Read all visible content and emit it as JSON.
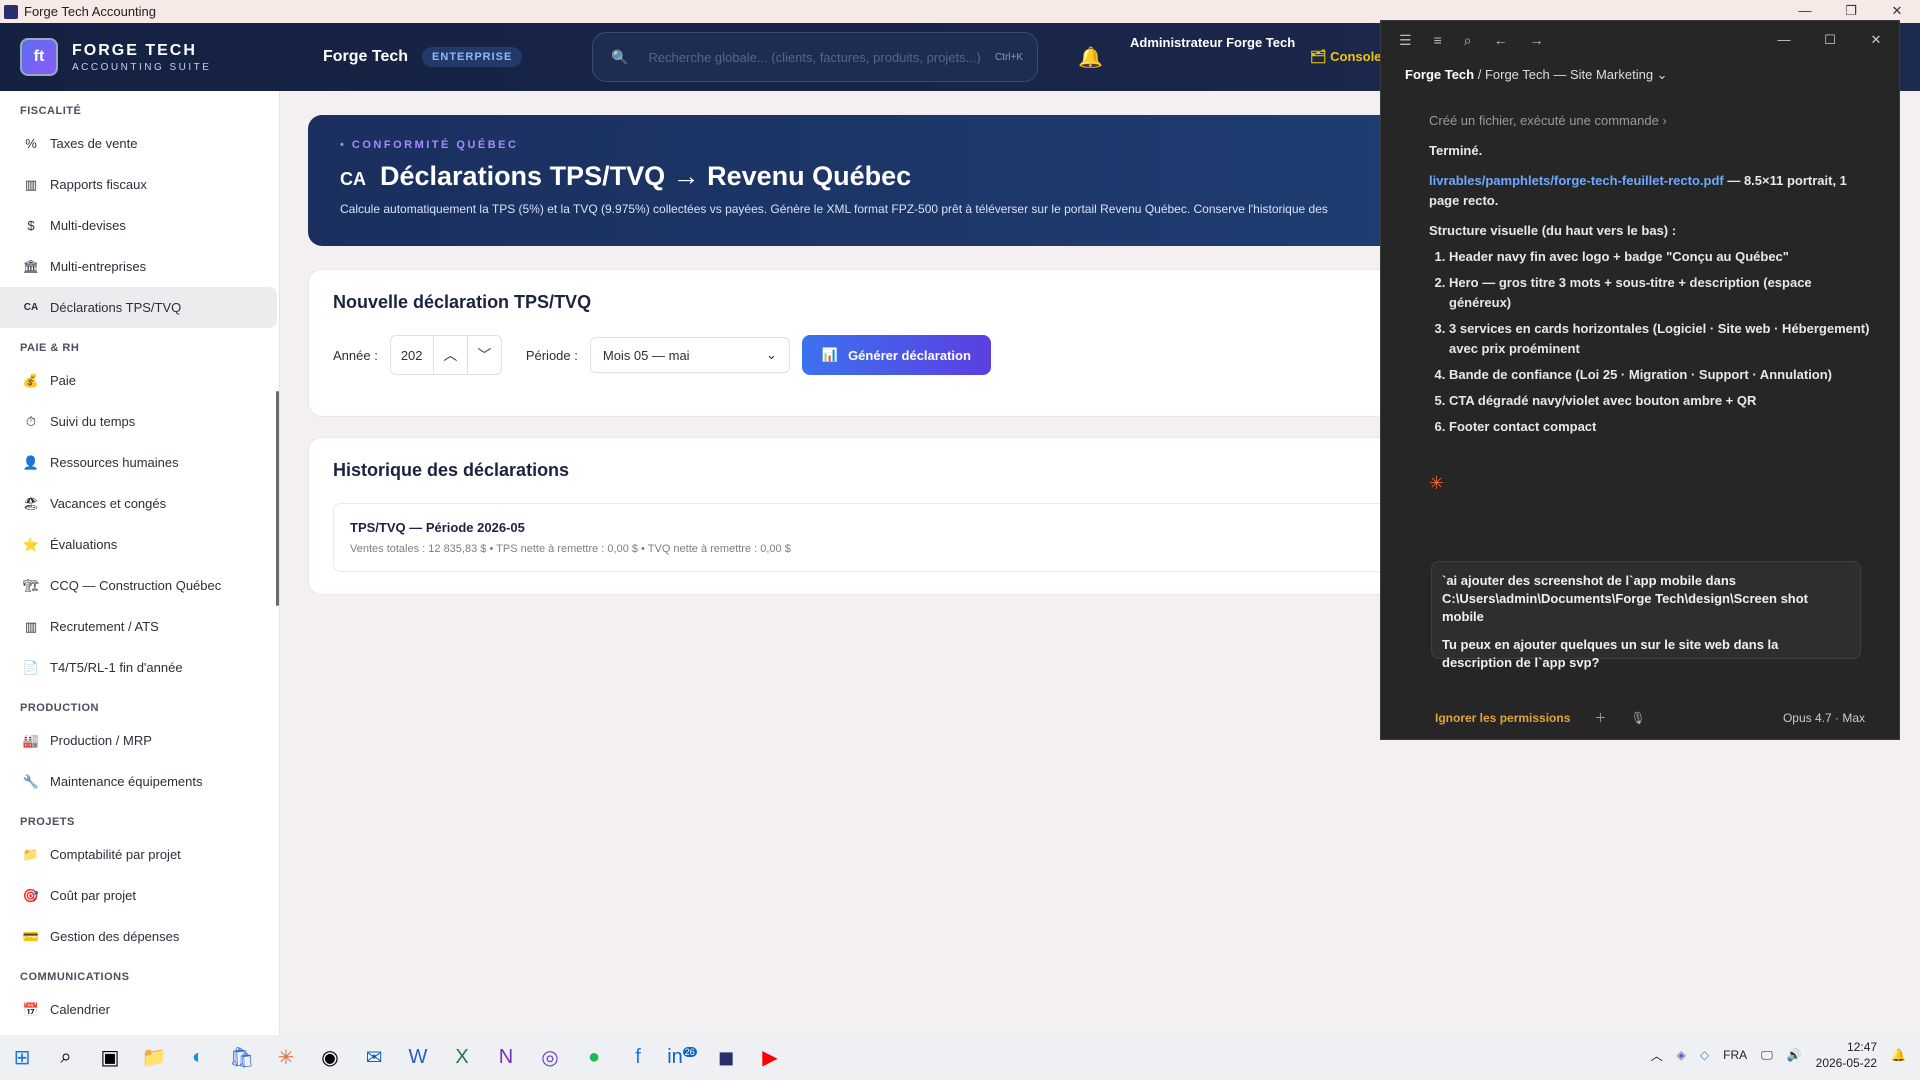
{
  "window": {
    "title": "Forge Tech Accounting"
  },
  "header": {
    "logo_main": "FORGE TECH",
    "logo_sub": "ACCOUNTING SUITE",
    "brand": "Forge Tech",
    "badge": "ENTERPRISE",
    "search_placeholder": "Recherche globale... (clients, factures, produits, projets...)",
    "search_shortcut": "Ctrl+K",
    "admin": "Administrateur Forge Tech",
    "console": "Console"
  },
  "sidebar": {
    "sections": [
      {
        "title": "FISCALITÉ",
        "items": [
          {
            "icon": "%",
            "label": "Taxes de vente"
          },
          {
            "icon": "▥",
            "label": "Rapports fiscaux"
          },
          {
            "icon": "$",
            "label": "Multi-devises"
          },
          {
            "icon": "🏛",
            "label": "Multi-entreprises"
          },
          {
            "icon": "CA",
            "label": "Déclarations TPS/TVQ",
            "active": true
          }
        ]
      },
      {
        "title": "PAIE & RH",
        "items": [
          {
            "icon": "💰",
            "label": "Paie"
          },
          {
            "icon": "⏱",
            "label": "Suivi du temps"
          },
          {
            "icon": "👤",
            "label": "Ressources humaines"
          },
          {
            "icon": "🏖",
            "label": "Vacances et congés"
          },
          {
            "icon": "⭐",
            "label": "Évaluations"
          },
          {
            "icon": "🏗",
            "label": "CCQ — Construction Québec"
          },
          {
            "icon": "▥",
            "label": "Recrutement / ATS"
          },
          {
            "icon": "📄",
            "label": "T4/T5/RL-1 fin d'année"
          }
        ]
      },
      {
        "title": "PRODUCTION",
        "items": [
          {
            "icon": "🏭",
            "label": "Production / MRP"
          },
          {
            "icon": "🔧",
            "label": "Maintenance équipements"
          }
        ]
      },
      {
        "title": "PROJETS",
        "items": [
          {
            "icon": "📁",
            "label": "Comptabilité par projet"
          },
          {
            "icon": "🎯",
            "label": "Coût par projet"
          },
          {
            "icon": "💳",
            "label": "Gestion des dépenses"
          }
        ]
      },
      {
        "title": "COMMUNICATIONS",
        "items": [
          {
            "icon": "📅",
            "label": "Calendrier"
          }
        ]
      }
    ]
  },
  "hero": {
    "kicker": "• CONFORMITÉ QUÉBEC",
    "ca": "CA",
    "title": "Déclarations TPS/TVQ → Revenu Québec",
    "description": "Calcule automatiquement la TPS (5%) et la TVQ (9.975%) collectées vs payées. Génère le XML format FPZ-500 prêt à téléverser sur le portail Revenu Québec. Conserve l'historique des"
  },
  "form": {
    "title": "Nouvelle déclaration TPS/TVQ",
    "year_label": "Année :",
    "year_value": "202",
    "period_label": "Période :",
    "period_value": "Mois 05 — mai",
    "generate": "Générer déclaration"
  },
  "history": {
    "title": "Historique des déclarations",
    "entries": [
      {
        "title": "TPS/TVQ — Période 2026-05",
        "detail": "Ventes totales : 12 835,83 $  •  TPS nette à remettre : 0,00 $  •  TVQ nette à remettre : 0,00 $"
      }
    ]
  },
  "panel": {
    "breadcrumb_root": "Forge Tech",
    "breadcrumb_rest": " / Forge Tech — Site Marketing ⌄",
    "activity": "Créé un fichier, exécuté une commande  ›",
    "done": "Terminé.",
    "file_link": "livrables/pamphlets/forge-tech-feuillet-recto.pdf",
    "file_note": " — 8.5×11 portrait, 1 page recto.",
    "structure_title": "Structure visuelle (du haut vers le bas) :",
    "structure": [
      "Header navy fin avec logo + badge \"Conçu au Québec\"",
      "Hero — gros titre 3 mots + sous-titre + description (espace généreux)",
      "3 services en cards horizontales (Logiciel · Site web · Hébergement) avec prix proéminent",
      "Bande de confiance (Loi 25 · Migration · Support · Annulation)",
      "CTA dégradé navy/violet avec bouton ambre + QR",
      "Footer contact compact"
    ],
    "input_text_1": "`ai ajouter des screenshot de l`app mobile dans C:\\Users\\admin\\Documents\\Forge Tech\\design\\Screen shot mobile",
    "input_text_2": "Tu peux en ajouter quelques un sur le site web dans la description de l`app svp?",
    "ignore": "Ignorer les permissions",
    "model": "Opus 4.7 · Max"
  },
  "taskbar": {
    "lang": "FRA",
    "time": "12:47",
    "date": "2026-05-22",
    "linkedin_badge": "26"
  }
}
